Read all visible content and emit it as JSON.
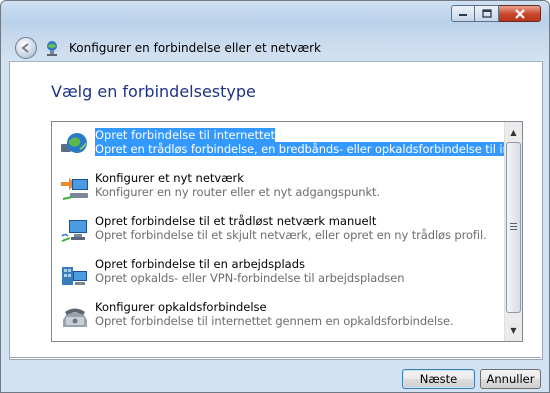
{
  "window": {
    "title": "Konfigurer en forbindelse eller et netværk"
  },
  "page": {
    "heading": "Vælg en forbindelsestype"
  },
  "options": [
    {
      "title": "Opret forbindelse til internettet",
      "desc": "Opret en trådløs forbindelse, en bredbånds- eller opkaldsforbindelse til internettet",
      "icon": "internet-globe-icon",
      "selected": true
    },
    {
      "title": "Konfigurer et nyt netværk",
      "desc": "Konfigurer en ny router eller et nyt adgangspunkt.",
      "icon": "router-setup-icon",
      "selected": false
    },
    {
      "title": "Opret forbindelse til et trådløst netværk manuelt",
      "desc": "Opret forbindelse til et skjult netværk, eller opret en ny trådløs profil.",
      "icon": "wireless-computer-icon",
      "selected": false
    },
    {
      "title": "Opret forbindelse til en arbejdsplads",
      "desc": "Opret opkalds- eller VPN-forbindelse til arbejdspladsen",
      "icon": "workplace-icon",
      "selected": false
    },
    {
      "title": "Konfigurer opkaldsforbindelse",
      "desc": "Opret forbindelse til internettet gennem en opkaldsforbindelse.",
      "icon": "dialup-phone-icon",
      "selected": false
    }
  ],
  "buttons": {
    "next": "Næste",
    "cancel": "Annuller"
  },
  "colors": {
    "selection": "#3399ff",
    "heading": "#1e3287"
  }
}
